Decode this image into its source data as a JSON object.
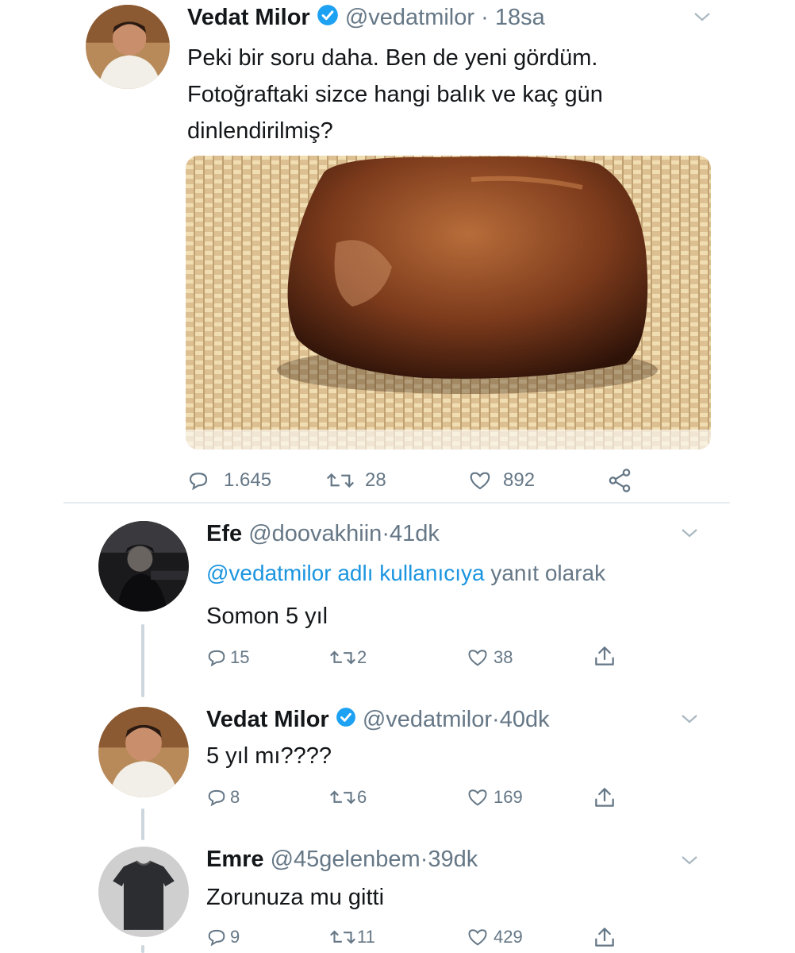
{
  "tweet": {
    "name": "Vedat Milor",
    "handle": "@vedatmilor",
    "sep": "·",
    "time": "18sa",
    "text_line1": "Peki bir soru daha. Ben de yeni gördüm.",
    "text_line2": "Fotoğraftaki sizce hangi balık ve kaç gün",
    "text_line3": "dinlendirilmiş?",
    "replies": "1.645",
    "retweets": "28",
    "likes": "892"
  },
  "replies": [
    {
      "name": "Efe",
      "handle": "@doovakhiin",
      "sep": "·",
      "time": "41dk",
      "reply_to_mention": "@vedatmilor adlı kullanıcıya",
      "reply_to_suffix": "yanıt olarak",
      "text": "Somon 5 yıl",
      "replies": "15",
      "retweets": "2",
      "likes": "38"
    },
    {
      "name": "Vedat Milor",
      "handle": "@vedatmilor",
      "sep": "·",
      "time": "40dk",
      "text": "5 yıl mı????",
      "replies": "8",
      "retweets": "6",
      "likes": "169"
    },
    {
      "name": "Emre",
      "handle": "@45gelenbem",
      "sep": "·",
      "time": "39dk",
      "text": "Zorunuza mu gitti",
      "replies": "9",
      "retweets": "11",
      "likes": "429"
    }
  ],
  "colors": {
    "accent": "#1da1f2",
    "mention": "#1b95e0",
    "muted": "#657786",
    "text": "#14171a"
  },
  "icons": [
    "reply-icon",
    "retweet-icon",
    "like-icon",
    "share-icon",
    "upload-icon",
    "verified-badge-icon",
    "chevron-down-icon"
  ]
}
